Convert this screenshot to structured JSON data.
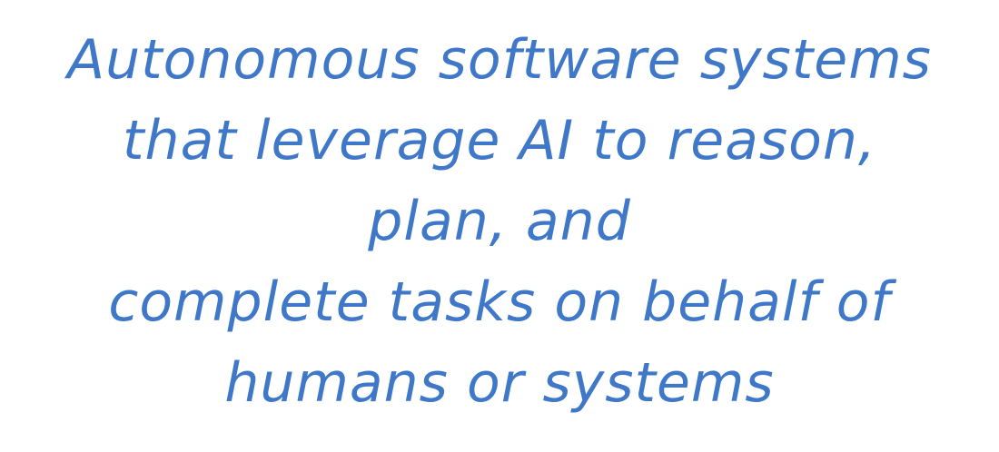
{
  "text_color": "#3f78c9",
  "lines": [
    "Autonomous software systems",
    "that leverage AI to reason,",
    "plan, and",
    "complete tasks on behalf of",
    "humans or systems"
  ]
}
